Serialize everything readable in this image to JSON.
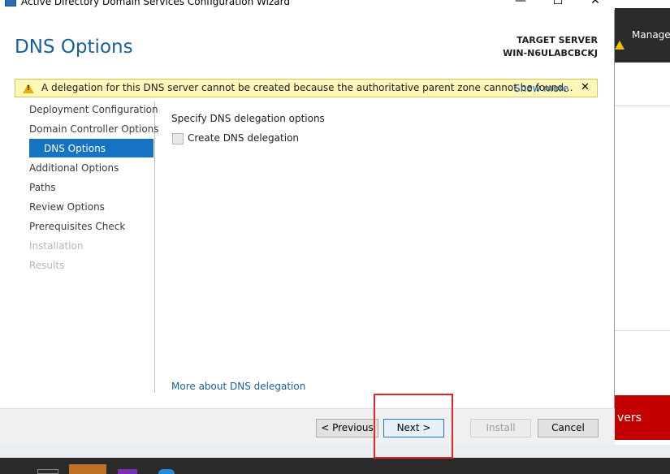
{
  "window": {
    "title": "Active Directory Domain Services Configuration Wizard",
    "minimize_glyph": "—",
    "maximize_glyph": "☐",
    "close_glyph": "✕"
  },
  "header": {
    "title": "DNS Options",
    "target_label": "TARGET SERVER",
    "target_name": "WIN-N6ULABCBCKJ"
  },
  "alert": {
    "icon": "warning-icon",
    "text": "A delegation for this DNS server cannot be created because the authoritative parent zone cannot be found...",
    "show_more": "Show more",
    "close_glyph": "✕"
  },
  "nav": {
    "items": [
      {
        "label": "Deployment Configuration",
        "state": "normal"
      },
      {
        "label": "Domain Controller Options",
        "state": "normal"
      },
      {
        "label": "DNS Options",
        "state": "active"
      },
      {
        "label": "Additional Options",
        "state": "normal"
      },
      {
        "label": "Paths",
        "state": "normal"
      },
      {
        "label": "Review Options",
        "state": "normal"
      },
      {
        "label": "Prerequisites Check",
        "state": "normal"
      },
      {
        "label": "Installation",
        "state": "disabled"
      },
      {
        "label": "Results",
        "state": "disabled"
      }
    ]
  },
  "content": {
    "section_title": "Specify DNS delegation options",
    "checkbox_label": "Create DNS delegation",
    "checkbox_checked": false,
    "more_link": "More about DNS delegation"
  },
  "footer": {
    "previous": "< Previous",
    "next": "Next >",
    "install": "Install",
    "cancel": "Cancel"
  },
  "background_app": {
    "manage": "Manage",
    "banner_text": "vers"
  },
  "colors": {
    "accent": "#1672c2",
    "title_blue": "#1a5e9a",
    "alert_bg": "#fff7b8",
    "highlight_red": "#e52626"
  }
}
